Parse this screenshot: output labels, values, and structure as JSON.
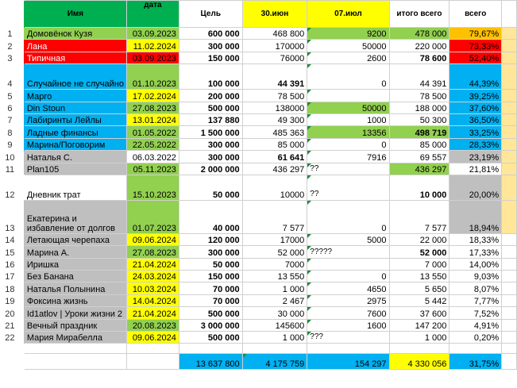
{
  "colors": {
    "green": "#92d050",
    "yellow": "#ffff00",
    "red": "#ff0000",
    "orange": "#ffc000",
    "blue": "#00b0f0",
    "grey": "#bfbfbf",
    "beige": "#ffe699",
    "pct_blue": "#00b0f0",
    "header_green": "#00b050"
  },
  "header": {
    "name": "Имя",
    "date": "дата",
    "goal": "Цель",
    "col_a": "30.июн",
    "col_b": "07.июл",
    "total": "итого всего",
    "pct": "всего"
  },
  "rows": [
    {
      "n": "1",
      "name": "Домовёнок Кузя",
      "date": "03.09.2023",
      "goal": "600 000",
      "a": "468 800",
      "b": "9200",
      "total": "478 000",
      "pct": "79,67%"
    },
    {
      "n": "2",
      "name": "Лана",
      "date": "11.02.2024",
      "goal": "300 000",
      "a": "170000",
      "b": "50000",
      "total": "220 000",
      "pct": "73,33%"
    },
    {
      "n": "3",
      "name": "Типичная",
      "date": "03.09.2023",
      "goal": "150 000",
      "a": "76000",
      "b": "2600",
      "total": "78 600",
      "pct": "52,40%"
    },
    {
      "n": "4",
      "name": "Случайное не случайно",
      "date": "01.10.2023",
      "goal": "100 000",
      "a": "44 391",
      "b": "0",
      "total": "44 391",
      "pct": "44,39%"
    },
    {
      "n": "5",
      "name": "Марго",
      "date": "17.02.2024",
      "goal": "200 000",
      "a": "78 500",
      "b": "",
      "total": "78 500",
      "pct": "39,25%"
    },
    {
      "n": "6",
      "name": "Din Stoun",
      "date": "27.08.2023",
      "goal": "500 000",
      "a": "138000",
      "b": "50000",
      "total": "188 000",
      "pct": "37,60%"
    },
    {
      "n": "7",
      "name": "Лабиринты Лейлы",
      "date": "13.01.2024",
      "goal": "137 880",
      "a": "49 300",
      "b": "1000",
      "total": "50 300",
      "pct": "36,50%"
    },
    {
      "n": "8",
      "name": "Ладные финансы",
      "date": "01.05.2022",
      "goal": "1 500 000",
      "a": "485 363",
      "b": "13356",
      "total": "498 719",
      "pct": "33,25%"
    },
    {
      "n": "9",
      "name": "Марина/Поговорим",
      "date": "22.05.2022",
      "goal": "300 000",
      "a": "85 000",
      "b": "0",
      "total": "85 000",
      "pct": "28,33%"
    },
    {
      "n": "10",
      "name": "Наталья С.",
      "date": "06.03.2022",
      "goal": "300 000",
      "a": "61 641",
      "b": "7916",
      "total": "69 557",
      "pct": "23,19%"
    },
    {
      "n": "11",
      "name": "Plan105",
      "date": "05.11.2023",
      "goal": "2 000 000",
      "a": "436 297",
      "note": "??",
      "b": "",
      "total": "436 297",
      "pct": "21,81%"
    },
    {
      "n": "12",
      "name": "Дневник трат",
      "date": "15.10.2023",
      "goal": "50 000",
      "a": "10000",
      "note": "??",
      "b": "",
      "total": "10 000",
      "pct": "20,00%"
    },
    {
      "n": "13",
      "name": "Екатерина и избавление от долгов",
      "date": "01.07.2023",
      "goal": "40 000",
      "a": "7 577",
      "b": "0",
      "total": "7 577",
      "pct": "18,94%"
    },
    {
      "n": "14",
      "name": "Летающая черепаха",
      "date": "09.06.2024",
      "goal": "120 000",
      "a": "17000",
      "b": "5000",
      "total": "22 000",
      "pct": "18,33%"
    },
    {
      "n": "15",
      "name": "Марина А.",
      "date": "27.08.2023",
      "goal": "300 000",
      "a": "52 000",
      "note": "?????",
      "b": "",
      "total": "52 000",
      "pct": "17,33%"
    },
    {
      "n": "16",
      "name": "Иришка",
      "date": "21.04.2024",
      "goal": "50 000",
      "a": "7000",
      "b": "",
      "total": "7 000",
      "pct": "14,00%"
    },
    {
      "n": "17",
      "name": "Без Банана",
      "date": "24.03.2024",
      "goal": "150 000",
      "a": "13 550",
      "b": "0",
      "total": "13 550",
      "pct": "9,03%"
    },
    {
      "n": "18",
      "name": "Наталья Полынина",
      "date": "10.03.2024",
      "goal": "70 000",
      "a": "1 000",
      "b": "4650",
      "total": "5 650",
      "pct": "8,07%"
    },
    {
      "n": "19",
      "name": "Фоксина жизнь",
      "date": "14.04.2024",
      "goal": "70 000",
      "a": "2 467",
      "b": "2975",
      "total": "5 442",
      "pct": "7,77%"
    },
    {
      "n": "20",
      "name": "Id1atlov | Уроки жизни 2",
      "date": "21.04.2024",
      "goal": "500 000",
      "a": "30 000",
      "b": "7600",
      "total": "37 600",
      "pct": "7,52%"
    },
    {
      "n": "21",
      "name": "Вечный праздник",
      "date": "20.08.2023",
      "goal": "3 000 000",
      "a": "145600",
      "b": "1600",
      "total": "147 200",
      "pct": "4,91%"
    },
    {
      "n": "22",
      "name": "Мария Мирабелла",
      "date": "09.06.2024",
      "goal": "500 000",
      "a": "1 000",
      "note": "???",
      "b": "",
      "total": "1 000",
      "pct": "0,20%"
    }
  ],
  "totals": {
    "goal": "13 637 800",
    "a": "4 175 759",
    "b": "154 297",
    "total": "4 330 056",
    "pct": "31,75%"
  }
}
